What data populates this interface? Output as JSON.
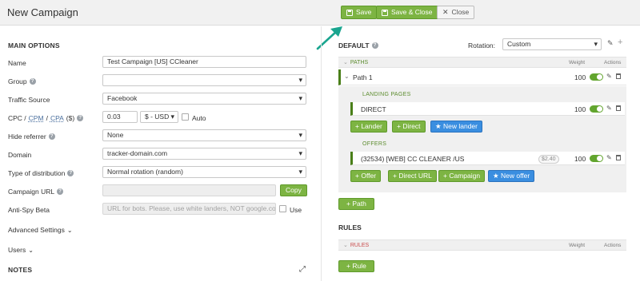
{
  "header": {
    "title": "New Campaign",
    "save_label": "Save",
    "save_close_label": "Save & Close",
    "close_label": "Close"
  },
  "colors": {
    "accent_green": "#7db443",
    "dark_green": "#4a7f19",
    "blue": "#3a8ee0",
    "rules_red": "#c94a4a",
    "arrow_teal": "#1aa58f"
  },
  "main_options": {
    "title": "MAIN OPTIONS",
    "name_label": "Name",
    "name_value": "Test Campaign [US] CCleaner",
    "group_label": "Group",
    "group_value": "",
    "traffic_label": "Traffic Source",
    "traffic_value": "Facebook",
    "cpc_label_a": "CPC /",
    "cpc_label_b": "CPM",
    "cpc_label_c": "/",
    "cpc_label_d": "CPA",
    "cpc_label_e": "($)",
    "cpc_value": "0.03",
    "currency_value": "$ - USD",
    "auto_label": "Auto",
    "hide_referrer_label": "Hide referrer",
    "hide_referrer_value": "None",
    "domain_label": "Domain",
    "domain_value": "tracker-domain.com",
    "distribution_label": "Type of distribution",
    "distribution_value": "Normal rotation (random)",
    "campaign_url_label": "Campaign URL",
    "campaign_url_value": "",
    "copy_label": "Copy",
    "antispy_label": "Anti-Spy Beta",
    "antispy_placeholder": "URL for bots. Please, use white landers, NOT google.com",
    "use_label": "Use",
    "advanced_label": "Advanced Settings",
    "users_label": "Users",
    "notes_label": "NOTES"
  },
  "default_panel": {
    "title": "DEFAULT",
    "rotation_label": "Rotation:",
    "rotation_value": "Custom",
    "paths_header": "PATHS",
    "weight_header": "Weight",
    "actions_header": "Actions",
    "path_name": "Path 1",
    "path_weight": "100",
    "landing_pages_label": "LANDING PAGES",
    "lander_name": "DIRECT",
    "lander_weight": "100",
    "lander_btn": "Lander",
    "direct_btn": "Direct",
    "new_lander_btn": "New lander",
    "offers_label": "OFFERS",
    "offer_name": "(32534) [WEB] CC CLEANER /US",
    "offer_price": "$2.40",
    "offer_weight": "100",
    "offer_btn": "Offer",
    "direct_url_btn": "Direct URL",
    "campaign_btn": "Campaign",
    "new_offer_btn": "New offer",
    "add_path_btn": "Path"
  },
  "rules_panel": {
    "title": "RULES",
    "rules_header": "RULES",
    "weight_header": "Weight",
    "actions_header": "Actions",
    "add_rule_btn": "Rule"
  },
  "icons": [
    "floppy-icon",
    "close-icon",
    "help-icon",
    "pin-icon",
    "trash-icon",
    "plus-icon",
    "chevron-down-icon",
    "expand-icon",
    "star-icon"
  ]
}
